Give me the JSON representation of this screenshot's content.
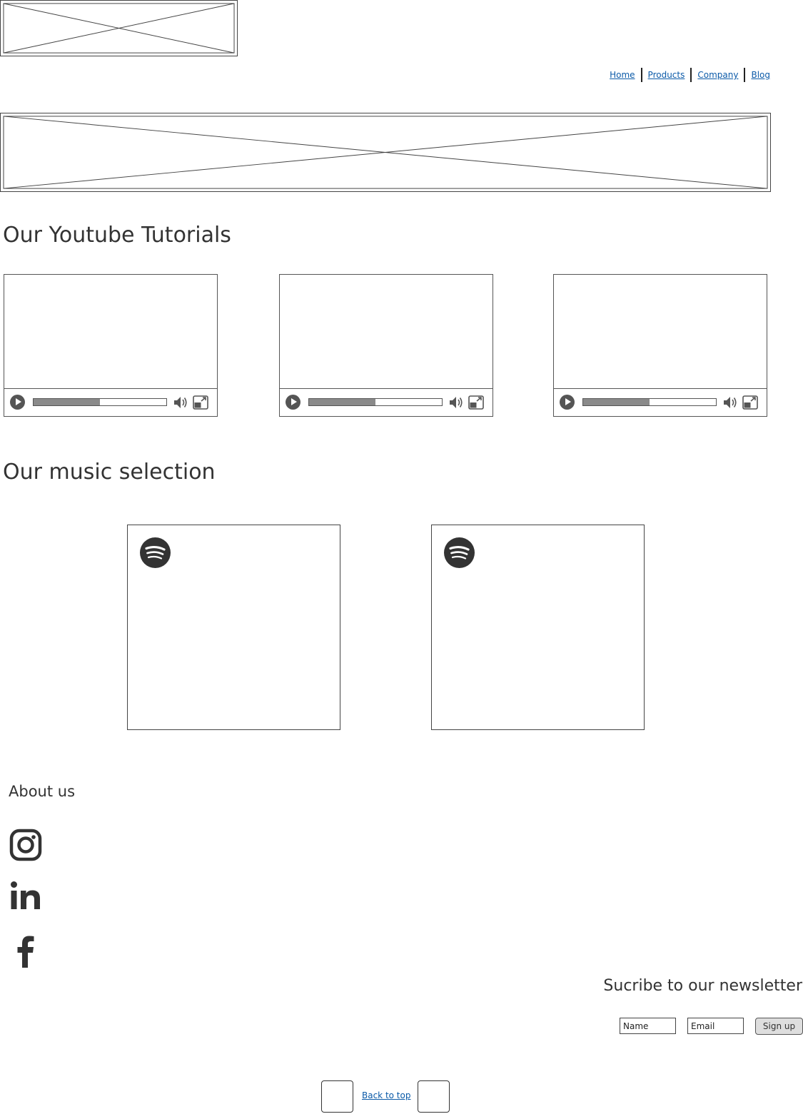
{
  "header": {
    "logo_icon": "image-placeholder-icon",
    "nav": [
      {
        "label": "Home"
      },
      {
        "label": "Products"
      },
      {
        "label": "Company"
      },
      {
        "label": "Blog"
      }
    ]
  },
  "banner": {
    "icon": "image-placeholder-icon"
  },
  "tutorials": {
    "title": "Our Youtube Tutorials",
    "videos": [
      {
        "progress": 0.5,
        "icons": [
          "play-icon",
          "volume-icon",
          "fullscreen-icon"
        ]
      },
      {
        "progress": 0.5,
        "icons": [
          "play-icon",
          "volume-icon",
          "fullscreen-icon"
        ]
      },
      {
        "progress": 0.5,
        "icons": [
          "play-icon",
          "volume-icon",
          "fullscreen-icon"
        ]
      }
    ]
  },
  "music": {
    "title": "Our music selection",
    "players": [
      {
        "icon": "spotify-icon"
      },
      {
        "icon": "spotify-icon"
      }
    ]
  },
  "about": {
    "title": "About us",
    "social": [
      {
        "icon": "instagram-icon"
      },
      {
        "icon": "linkedin-icon"
      },
      {
        "icon": "facebook-icon"
      }
    ]
  },
  "newsletter": {
    "title": "Sucribe to our newsletter",
    "name_placeholder": "Name",
    "email_placeholder": "Email",
    "signup_label": "Sign up"
  },
  "footer": {
    "back_to_top": "Back to top"
  },
  "colors": {
    "link": "#0b5aa8",
    "text": "#333333",
    "progress_fill": "#8a8a8a",
    "button_bg": "#dedede"
  }
}
